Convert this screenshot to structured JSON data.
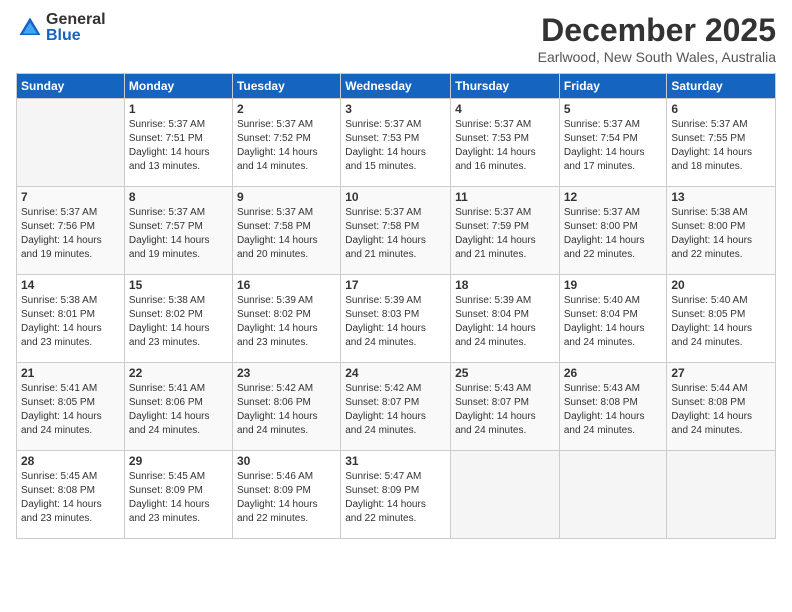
{
  "logo": {
    "general": "General",
    "blue": "Blue"
  },
  "header": {
    "month": "December 2025",
    "location": "Earlwood, New South Wales, Australia"
  },
  "weekdays": [
    "Sunday",
    "Monday",
    "Tuesday",
    "Wednesday",
    "Thursday",
    "Friday",
    "Saturday"
  ],
  "weeks": [
    [
      {
        "day": "",
        "info": ""
      },
      {
        "day": "1",
        "info": "Sunrise: 5:37 AM\nSunset: 7:51 PM\nDaylight: 14 hours\nand 13 minutes."
      },
      {
        "day": "2",
        "info": "Sunrise: 5:37 AM\nSunset: 7:52 PM\nDaylight: 14 hours\nand 14 minutes."
      },
      {
        "day": "3",
        "info": "Sunrise: 5:37 AM\nSunset: 7:53 PM\nDaylight: 14 hours\nand 15 minutes."
      },
      {
        "day": "4",
        "info": "Sunrise: 5:37 AM\nSunset: 7:53 PM\nDaylight: 14 hours\nand 16 minutes."
      },
      {
        "day": "5",
        "info": "Sunrise: 5:37 AM\nSunset: 7:54 PM\nDaylight: 14 hours\nand 17 minutes."
      },
      {
        "day": "6",
        "info": "Sunrise: 5:37 AM\nSunset: 7:55 PM\nDaylight: 14 hours\nand 18 minutes."
      }
    ],
    [
      {
        "day": "7",
        "info": "Sunrise: 5:37 AM\nSunset: 7:56 PM\nDaylight: 14 hours\nand 19 minutes."
      },
      {
        "day": "8",
        "info": "Sunrise: 5:37 AM\nSunset: 7:57 PM\nDaylight: 14 hours\nand 19 minutes."
      },
      {
        "day": "9",
        "info": "Sunrise: 5:37 AM\nSunset: 7:58 PM\nDaylight: 14 hours\nand 20 minutes."
      },
      {
        "day": "10",
        "info": "Sunrise: 5:37 AM\nSunset: 7:58 PM\nDaylight: 14 hours\nand 21 minutes."
      },
      {
        "day": "11",
        "info": "Sunrise: 5:37 AM\nSunset: 7:59 PM\nDaylight: 14 hours\nand 21 minutes."
      },
      {
        "day": "12",
        "info": "Sunrise: 5:37 AM\nSunset: 8:00 PM\nDaylight: 14 hours\nand 22 minutes."
      },
      {
        "day": "13",
        "info": "Sunrise: 5:38 AM\nSunset: 8:00 PM\nDaylight: 14 hours\nand 22 minutes."
      }
    ],
    [
      {
        "day": "14",
        "info": "Sunrise: 5:38 AM\nSunset: 8:01 PM\nDaylight: 14 hours\nand 23 minutes."
      },
      {
        "day": "15",
        "info": "Sunrise: 5:38 AM\nSunset: 8:02 PM\nDaylight: 14 hours\nand 23 minutes."
      },
      {
        "day": "16",
        "info": "Sunrise: 5:39 AM\nSunset: 8:02 PM\nDaylight: 14 hours\nand 23 minutes."
      },
      {
        "day": "17",
        "info": "Sunrise: 5:39 AM\nSunset: 8:03 PM\nDaylight: 14 hours\nand 24 minutes."
      },
      {
        "day": "18",
        "info": "Sunrise: 5:39 AM\nSunset: 8:04 PM\nDaylight: 14 hours\nand 24 minutes."
      },
      {
        "day": "19",
        "info": "Sunrise: 5:40 AM\nSunset: 8:04 PM\nDaylight: 14 hours\nand 24 minutes."
      },
      {
        "day": "20",
        "info": "Sunrise: 5:40 AM\nSunset: 8:05 PM\nDaylight: 14 hours\nand 24 minutes."
      }
    ],
    [
      {
        "day": "21",
        "info": "Sunrise: 5:41 AM\nSunset: 8:05 PM\nDaylight: 14 hours\nand 24 minutes."
      },
      {
        "day": "22",
        "info": "Sunrise: 5:41 AM\nSunset: 8:06 PM\nDaylight: 14 hours\nand 24 minutes."
      },
      {
        "day": "23",
        "info": "Sunrise: 5:42 AM\nSunset: 8:06 PM\nDaylight: 14 hours\nand 24 minutes."
      },
      {
        "day": "24",
        "info": "Sunrise: 5:42 AM\nSunset: 8:07 PM\nDaylight: 14 hours\nand 24 minutes."
      },
      {
        "day": "25",
        "info": "Sunrise: 5:43 AM\nSunset: 8:07 PM\nDaylight: 14 hours\nand 24 minutes."
      },
      {
        "day": "26",
        "info": "Sunrise: 5:43 AM\nSunset: 8:08 PM\nDaylight: 14 hours\nand 24 minutes."
      },
      {
        "day": "27",
        "info": "Sunrise: 5:44 AM\nSunset: 8:08 PM\nDaylight: 14 hours\nand 24 minutes."
      }
    ],
    [
      {
        "day": "28",
        "info": "Sunrise: 5:45 AM\nSunset: 8:08 PM\nDaylight: 14 hours\nand 23 minutes."
      },
      {
        "day": "29",
        "info": "Sunrise: 5:45 AM\nSunset: 8:09 PM\nDaylight: 14 hours\nand 23 minutes."
      },
      {
        "day": "30",
        "info": "Sunrise: 5:46 AM\nSunset: 8:09 PM\nDaylight: 14 hours\nand 22 minutes."
      },
      {
        "day": "31",
        "info": "Sunrise: 5:47 AM\nSunset: 8:09 PM\nDaylight: 14 hours\nand 22 minutes."
      },
      {
        "day": "",
        "info": ""
      },
      {
        "day": "",
        "info": ""
      },
      {
        "day": "",
        "info": ""
      }
    ]
  ]
}
